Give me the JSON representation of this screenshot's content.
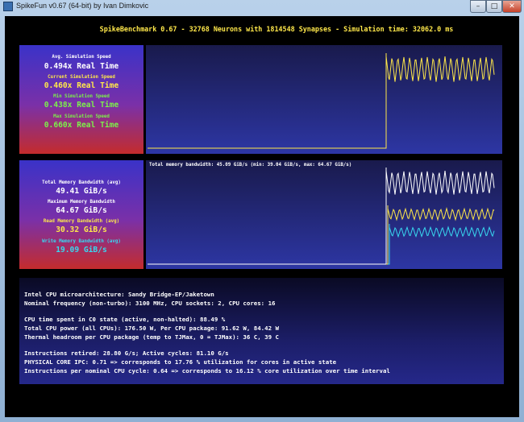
{
  "window": {
    "title": "SpikeFun v0.67 (64-bit) by Ivan Dimkovic",
    "minimize_glyph": "–",
    "maximize_glyph": "□",
    "close_glyph": "✕"
  },
  "header": {
    "title": "SpikeBenchmark 0.67 - 32768 Neurons with 1814548 Synapses - Simulation time: 32062.0 ms"
  },
  "speed_panel": {
    "stats": [
      {
        "label": "Avg. Simulation Speed",
        "value": "0.494x Real Time",
        "color": "#ffffff"
      },
      {
        "label": "Current Simulation Speed",
        "value": "0.460x Real Time",
        "color": "#ffe84a"
      },
      {
        "label": "Min Simulation Speed",
        "value": "0.438x Real Time",
        "color": "#7cf04a"
      },
      {
        "label": "Max Simulation Speed",
        "value": "0.660x Real Time",
        "color": "#7cf04a"
      }
    ]
  },
  "memory_panel": {
    "stats": [
      {
        "label": "Total Memory Bandwidth (avg)",
        "value": "49.41 GiB/s",
        "color": "#ffffff"
      },
      {
        "label": "Maximum Memory Bandwidth",
        "value": "64.67 GiB/s",
        "color": "#ffffff"
      },
      {
        "label": "Read Memory Bandwidth (avg)",
        "value": "30.32 GiB/s",
        "color": "#ffe84a"
      },
      {
        "label": "Write Memory Bandwidth (avg)",
        "value": "19.09 GiB/s",
        "color": "#38d8f0"
      }
    ],
    "graph_caption": "Total memory bandwidth: 45.09 GiB/s (min: 39.04 GiB/s, max: 64.67 GiB/s)"
  },
  "cpu_info": {
    "lines": [
      "Intel CPU microarchitecture: Sandy Bridge-EP/Jaketown",
      "Nominal frequency (non-turbo): 3100 MHz, CPU sockets: 2,  CPU cores: 16",
      "",
      "CPU time spent in C0 state (active, non-halted): 88.49 %",
      "Total CPU power (all CPUs): 176.50 W,  Per CPU package: 91.62 W, 84.42 W",
      "Thermal headroom per CPU package (temp to TJMax, 0 = TJMax): 36 C, 39 C",
      "",
      "Instructions retired: 28.80 G/s; Active cycles: 81.10 G/s",
      "PHYSICAL CORE IPC: 0.71 => corresponds to 17.76 % utilization for cores in active state",
      "Instructions per nominal CPU cycle: 0.64 => corresponds to 16.12 % core utilization over time interval"
    ]
  },
  "colors": {
    "speed_line": "#ffe84a",
    "total_bw_line": "#ffffff",
    "read_bw_line": "#ffe84a",
    "write_bw_line": "#38d8f0"
  }
}
